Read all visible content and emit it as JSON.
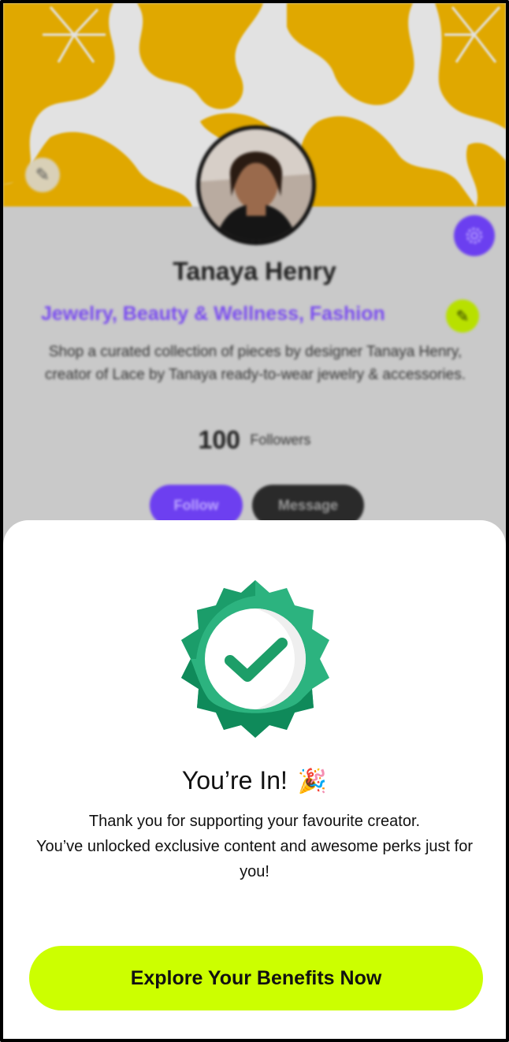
{
  "profile": {
    "name": "Tanaya Henry",
    "categories": "Jewelry, Beauty & Wellness, Fashion",
    "bio": "Shop a curated collection of pieces by designer Tanaya Henry, creator of Lace by Tanaya ready-to-wear jewelry & accessories.",
    "followers_count": "100",
    "followers_label": "Followers",
    "follow_label": "Follow",
    "message_label": "Message"
  },
  "icons": {
    "cover_edit": "pencil-icon",
    "categories_edit": "pencil-icon",
    "settings": "gear-icon",
    "badge": "verified-check-badge-icon",
    "celebration": "party-popper-icon"
  },
  "colors": {
    "accent_purple": "#6d3ff0",
    "accent_lime": "#ccff00",
    "badge_green": "#1f9e6a",
    "cover_yellow": "#e0a800"
  },
  "sheet": {
    "title": "You’re In!",
    "title_emoji": "🎉",
    "message_line_1": "Thank you for supporting your favourite creator.",
    "message_line_2": "You’ve unlocked exclusive content and awesome perks just for you!",
    "cta_label": "Explore Your Benefits Now"
  }
}
